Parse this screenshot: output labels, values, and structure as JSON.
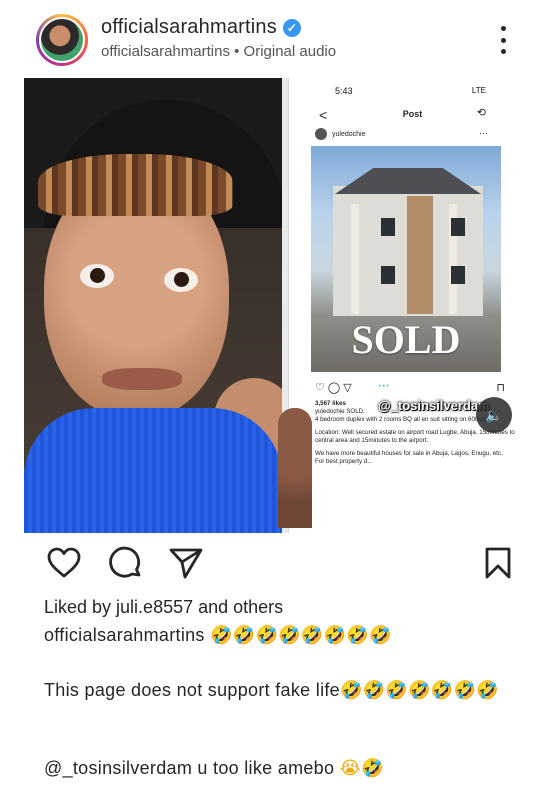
{
  "post": {
    "username": "officialsarahmartins",
    "subline": "officialsarahmartins • Original audio",
    "verified_icon": "verified-badge-icon",
    "more_icon": "more-vertical-icon"
  },
  "media": {
    "phone_screen": {
      "status_time": "5:43",
      "status_network": "LTE",
      "nav_title": "Post",
      "nav_back": "<",
      "poster": "yuledochie",
      "sold_text": "SOLD",
      "likes": "3,567 likes",
      "caption_lines": [
        "yuledochie SOLD.",
        "4 bedroom duplex with 2 rooms BQ all en suit sitting on 600sqm.",
        "Location: Well secured estate on airport road Lugbe, Abuja. 15minutes to central area and 15minutes to the airport.",
        "We have more beautiful houses for sale in Abuja, Lagos, Enugu, etc.",
        "For best property d..."
      ]
    },
    "watermark": "@_tosinsilverdam",
    "sound_icon": "speaker-muted-icon"
  },
  "actions": {
    "like_icon": "heart-icon",
    "comment_icon": "comment-bubble-icon",
    "share_icon": "paper-plane-icon",
    "save_icon": "bookmark-icon"
  },
  "liked_by": "Liked by juli.e8557 and others",
  "caption": {
    "username": "officialsarahmartins",
    "emojis": "🤣🤣🤣🤣🤣🤣🤣🤣"
  },
  "comments": [
    {
      "text": "This page does not support fake life",
      "emojis": "🤣🤣🤣🤣🤣🤣🤣"
    },
    {
      "mention": "@_tosinsilverdam",
      "text": " u too like amebo ",
      "emojis": "😭🤣"
    }
  ]
}
